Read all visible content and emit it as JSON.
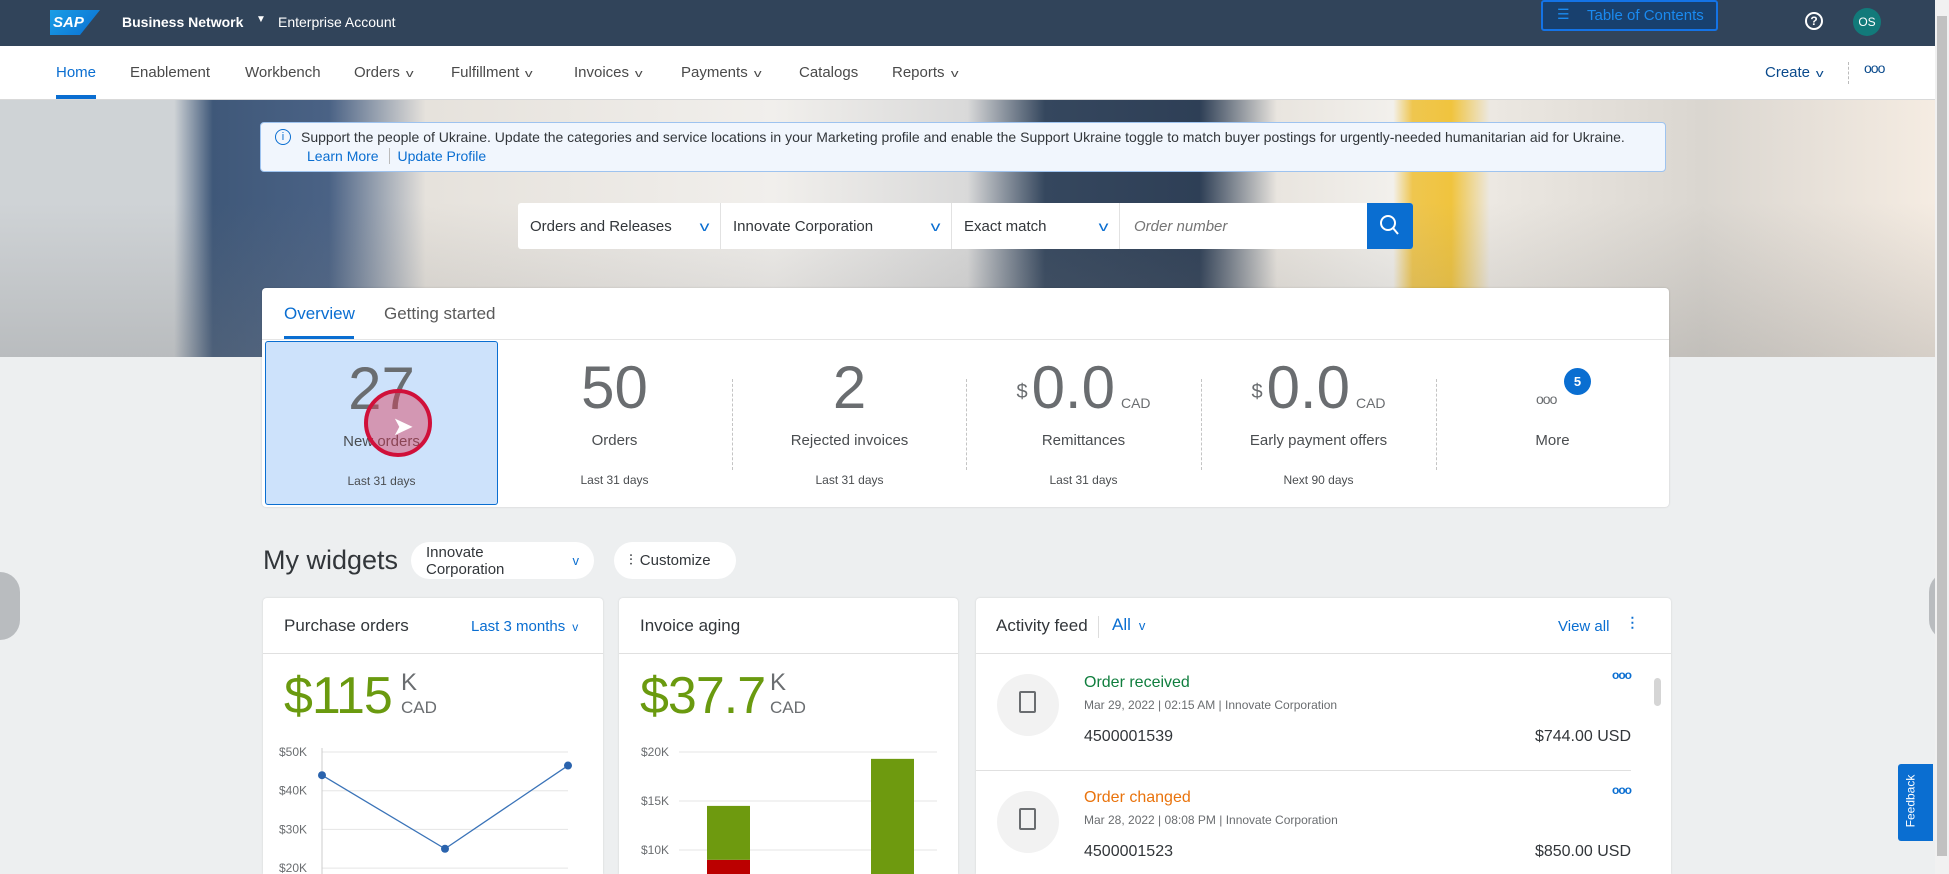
{
  "header": {
    "brand_logo": "SAP",
    "product": "Business Network",
    "account": "Enterprise Account",
    "toc_label": "Table of Contents",
    "help_icon": "question-circle-icon",
    "avatar_initials": "OS"
  },
  "nav": {
    "items": [
      {
        "label": "Home",
        "active": true
      },
      {
        "label": "Enablement"
      },
      {
        "label": "Workbench"
      },
      {
        "label": "Orders",
        "dropdown": true
      },
      {
        "label": "Fulfillment",
        "dropdown": true
      },
      {
        "label": "Invoices",
        "dropdown": true
      },
      {
        "label": "Payments",
        "dropdown": true
      },
      {
        "label": "Catalogs"
      },
      {
        "label": "Reports",
        "dropdown": true
      }
    ],
    "create_label": "Create",
    "more_icon": "ellipsis-icon"
  },
  "banner": {
    "text": "Support the people of Ukraine. Update the categories and service locations in your Marketing profile and enable the Support Ukraine toggle to match buyer postings for urgently-needed humanitarian aid for Ukraine.",
    "learn_more": "Learn More",
    "update_profile": "Update Profile"
  },
  "search": {
    "type": "Orders and Releases",
    "company": "Innovate Corporation",
    "match": "Exact match",
    "placeholder": "Order number"
  },
  "overview": {
    "tabs": [
      "Overview",
      "Getting started"
    ],
    "kpis": [
      {
        "value": "27",
        "label": "New orders",
        "sub": "Last 31 days",
        "selected": true
      },
      {
        "value": "50",
        "label": "Orders",
        "sub": "Last 31 days"
      },
      {
        "value": "2",
        "label": "Rejected invoices",
        "sub": "Last 31 days"
      },
      {
        "currency": "$",
        "value": "0.0",
        "unit": "CAD",
        "label": "Remittances",
        "sub": "Last 31 days"
      },
      {
        "currency": "$",
        "value": "0.0",
        "unit": "CAD",
        "label": "Early payment offers",
        "sub": "Next 90 days"
      },
      {
        "label": "More",
        "badge": "5"
      }
    ]
  },
  "widgets": {
    "title": "My widgets",
    "company": "Innovate Corporation",
    "customize": "Customize",
    "purchase_orders": {
      "title": "Purchase orders",
      "period": "Last 3 months",
      "value": "$115",
      "magnitude": "K",
      "unit": "CAD"
    },
    "invoice_aging": {
      "title": "Invoice aging",
      "value": "$37.7",
      "magnitude": "K",
      "unit": "CAD"
    },
    "activity": {
      "title": "Activity feed",
      "filter": "All",
      "view_all": "View all",
      "items": [
        {
          "title": "Order received",
          "status_color": "#107e3e",
          "date": "Mar 29, 2022",
          "time": "02:15 AM",
          "company": "Innovate Corporation",
          "number": "4500001539",
          "amount": "$744.00 USD"
        },
        {
          "title": "Order changed",
          "status_color": "#e9730c",
          "date": "Mar 28, 2022",
          "time": "08:08 PM",
          "company": "Innovate Corporation",
          "number": "4500001523",
          "amount": "$850.00 USD"
        }
      ]
    }
  },
  "feedback": "Feedback",
  "chart_data": [
    {
      "type": "line",
      "ylabel_ticks": [
        "$50K",
        "$40K",
        "$30K",
        "$20K"
      ],
      "y_units": "K USD",
      "values": [
        44,
        25,
        46.5
      ],
      "ylim_visible": [
        20,
        50
      ],
      "color": "#3a73b8",
      "grid": true
    },
    {
      "type": "bar",
      "stacked": true,
      "ylabel_ticks": [
        "$20K",
        "$15K",
        "$10K"
      ],
      "ylim_visible": [
        10,
        20
      ],
      "series": [
        {
          "color": "#bb0000",
          "values": [
            9,
            0
          ]
        },
        {
          "color": "#6e9a0f",
          "values": [
            5.5,
            19.3
          ]
        }
      ],
      "grid": true
    }
  ],
  "colors": {
    "header": "#31445a",
    "accent": "#0a6ed1",
    "positive": "#6a9a0f"
  }
}
